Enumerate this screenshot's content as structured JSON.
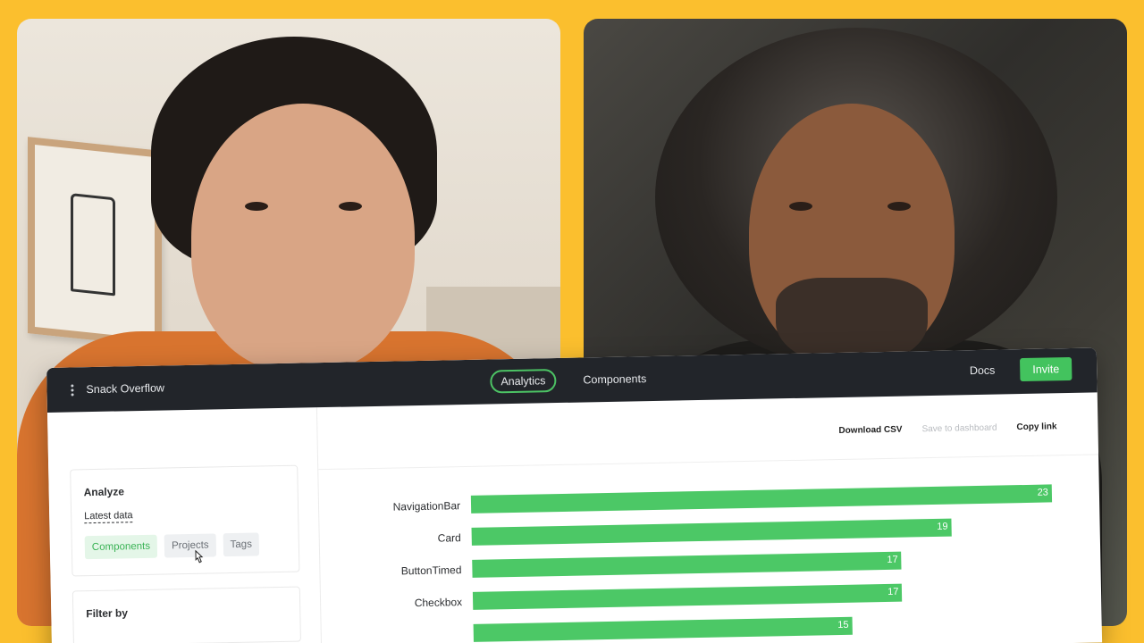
{
  "app": {
    "title": "Snack Overflow",
    "nav": [
      {
        "label": "Analytics",
        "active": true
      },
      {
        "label": "Components",
        "active": false
      }
    ],
    "docs_label": "Docs",
    "invite_label": "Invite"
  },
  "sidebar": {
    "analyze": {
      "title": "Analyze",
      "latest_label": "Latest data",
      "chips": [
        {
          "label": "Components",
          "active": true
        },
        {
          "label": "Projects",
          "active": false
        },
        {
          "label": "Tags",
          "active": false
        }
      ]
    },
    "filter": {
      "title": "Filter by"
    }
  },
  "actions": {
    "download_csv": "Download CSV",
    "save_to_dashboard": "Save to dashboard",
    "copy_link": "Copy link"
  },
  "colors": {
    "background": "#fbbf2e",
    "accent_green": "#43c35e",
    "topbar": "#22252a"
  },
  "chart_data": {
    "type": "bar",
    "orientation": "horizontal",
    "categories": [
      "NavigationBar",
      "Card",
      "ButtonTimed",
      "Checkbox",
      ""
    ],
    "values": [
      23,
      19,
      17,
      17,
      15
    ],
    "xlim": [
      0,
      23
    ],
    "grid": false
  }
}
